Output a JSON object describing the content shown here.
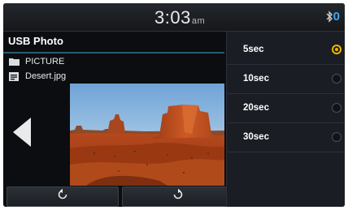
{
  "status": {
    "clock": "3:03",
    "ampm": "am",
    "bluetooth_count": "0",
    "accent": "#3aa6ff"
  },
  "panel": {
    "title": "USB Photo",
    "folder": {
      "icon": "folder-icon",
      "label": "PICTURE"
    },
    "file": {
      "icon": "image-file-icon",
      "label": "Desert.jpg"
    },
    "controls": {
      "prev_icon": "previous-arrow-icon",
      "rotate_left_icon": "rotate-counterclockwise-icon",
      "rotate_right_icon": "rotate-clockwise-icon"
    }
  },
  "slideshow_menu": {
    "selected_color": "#f0b400",
    "items": [
      {
        "label": "5sec",
        "selected": true
      },
      {
        "label": "10sec",
        "selected": false
      },
      {
        "label": "20sec",
        "selected": false
      },
      {
        "label": "30sec",
        "selected": false
      }
    ]
  }
}
